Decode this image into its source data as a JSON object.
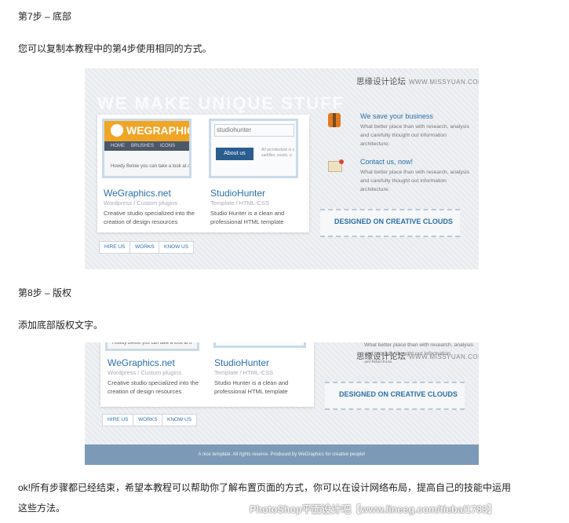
{
  "step7": {
    "heading": "第7步 – 底部",
    "desc": "您可以复制本教程中的第4步使用相同的方式。"
  },
  "step8": {
    "heading": "第8步 – 版权",
    "desc": "添加底部版权文字。"
  },
  "conclusion": {
    "line1": "ok!所有步骤都已经结束，希望本教程可以帮助你了解布置页面的方式，你可以在设计网络布局，提高自己的技能中运用",
    "line2": "这些方法。"
  },
  "watermark": {
    "cn": "思缘设计论坛",
    "url": "WWW.MISSYUAN.COM"
  },
  "bottom_watermark": "PhotoShop平面设计吧【www.lineeg.com/tieba/1783】",
  "site": {
    "tagline": "WE MAKE UNIQUE STUFF",
    "projects": [
      {
        "name": "WeGraphics.net",
        "sub": "Wordpress / Custom plugins",
        "desc": "Creative studio specialized into the creation of design resources",
        "logo": "WEGRAPHICS",
        "nav": [
          "HOME",
          "BRUSHES",
          "ICONS"
        ],
        "howdy": "Howdy",
        "howdy_tail": "Below you can take a look at o"
      },
      {
        "name": "StudioHunter",
        "sub": "Template / HTML-CSS",
        "desc": "Studio Hunter is a clean and professional HTML template",
        "logo": "studiohunter",
        "button": "About us",
        "side_text": "All architecture is s saddles, exotic, o"
      }
    ],
    "features": [
      {
        "title": "We save your business",
        "desc": "What better place than with research, analysis and carefully thought out information architecture.",
        "icon": "safety-vest-icon"
      },
      {
        "title": "Contact us, now!",
        "desc": "What better place than with research, analysis and carefully thought out information architecture.",
        "icon": "envelope-icon"
      }
    ],
    "ribbon": "DESIGNED ON CREATIVE CLOUDS",
    "footer_links": [
      "HIRE US",
      "WORKS",
      "KNOW US"
    ],
    "copyright": "A nice template. All rights reserve. Produced by WeGraphics for creative people!"
  },
  "colors": {
    "accent": "#2a6fa8",
    "orange": "#f0a524",
    "footer": "#7c9ab8"
  }
}
